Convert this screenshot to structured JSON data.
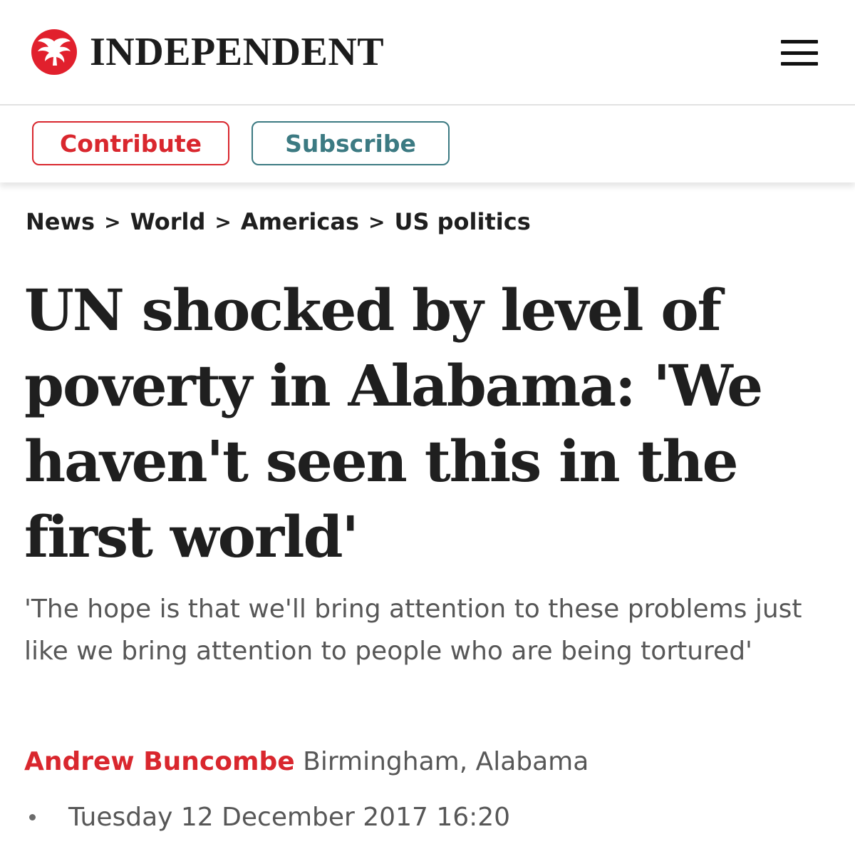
{
  "header": {
    "logo_text": "INDEPENDENT",
    "menu_icon": "hamburger-menu-icon"
  },
  "actions": {
    "contribute_label": "Contribute",
    "subscribe_label": "Subscribe"
  },
  "breadcrumb": {
    "items": [
      "News",
      "World",
      "Americas",
      "US politics"
    ],
    "separator": ">"
  },
  "article": {
    "headline": "UN shocked by level of poverty in Alabama: 'We haven't seen this in the first world'",
    "standfirst": "'The hope is that we'll bring attention to these problems just like we bring attention to people who are being tortured'",
    "author": "Andrew Buncombe",
    "location": "Birmingham, Alabama",
    "date": "Tuesday 12 December 2017 16:20"
  },
  "colors": {
    "brand_red": "#d9272e",
    "subscribe_teal": "#3c7a82",
    "text_dark": "#1f1f1f",
    "text_grey": "#575757"
  }
}
